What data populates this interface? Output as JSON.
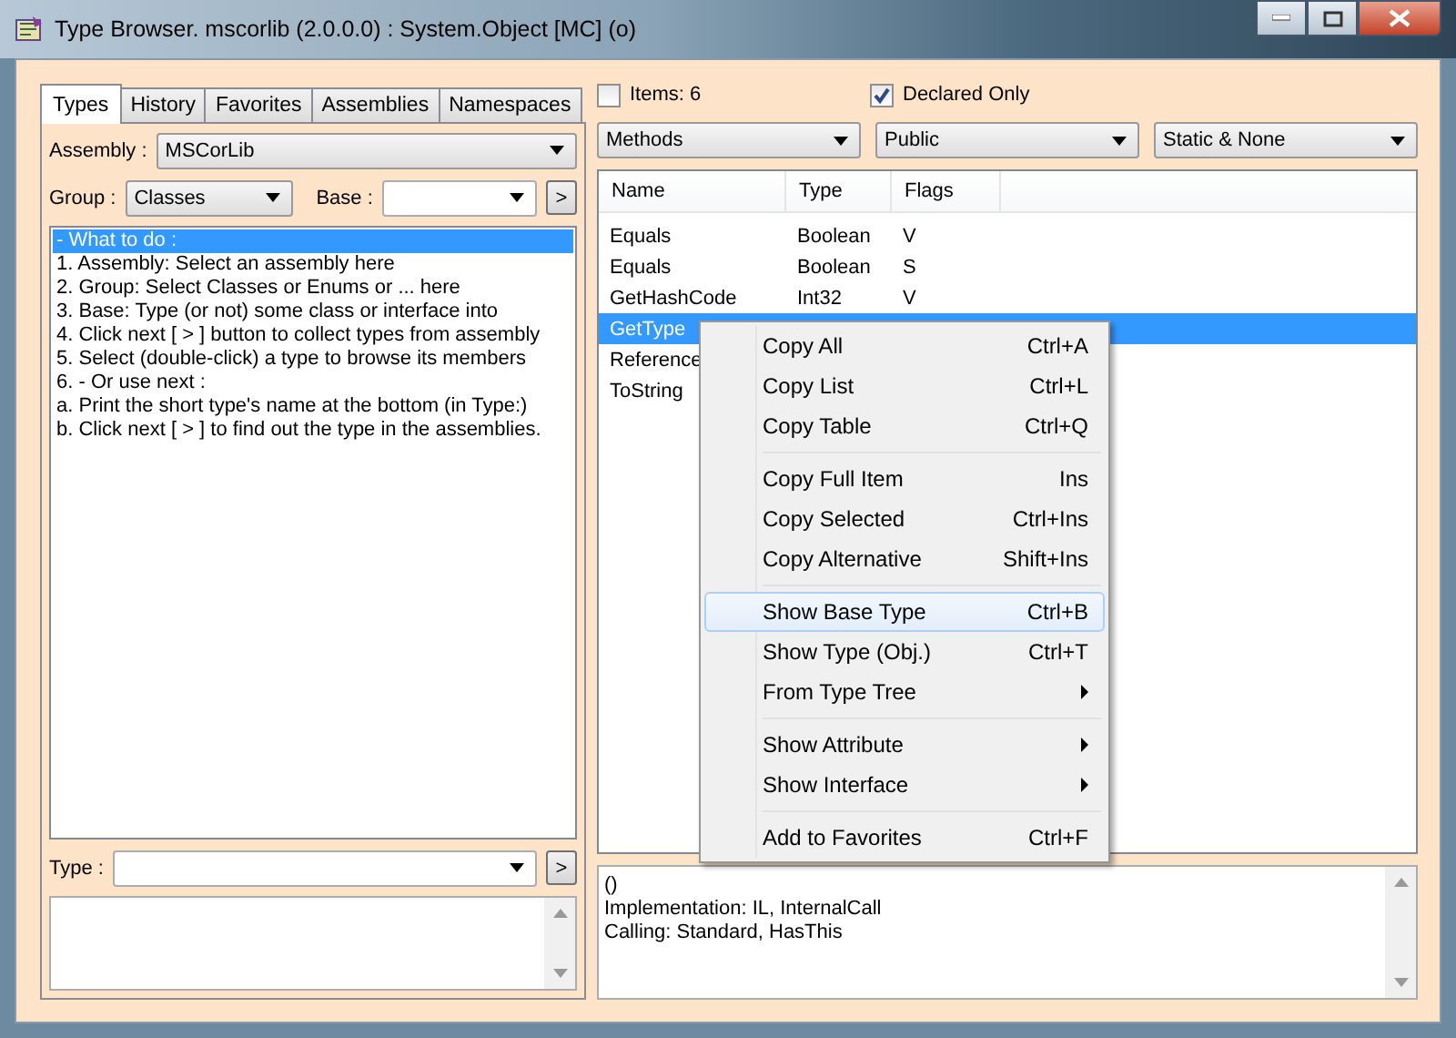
{
  "window": {
    "title": "Type Browser. mscorlib (2.0.0.0) : System.Object [MC] (o)"
  },
  "left_panel": {
    "tabs": [
      {
        "label": "Types",
        "selected": true
      },
      {
        "label": "History",
        "selected": false
      },
      {
        "label": "Favorites",
        "selected": false
      },
      {
        "label": "Assemblies",
        "selected": false
      },
      {
        "label": "Namespaces",
        "selected": false
      }
    ],
    "assembly": {
      "label": "Assembly :",
      "value": "MSCorLib"
    },
    "group": {
      "label": "Group :",
      "value": "Classes"
    },
    "base": {
      "label": "Base :"
    },
    "base_go_button": ">",
    "instructions": [
      {
        "text": "- What to do :",
        "selected": true
      },
      {
        "text": "1. Assembly: Select an assembly here",
        "selected": false
      },
      {
        "text": "2. Group: Select Classes or Enums or ... here",
        "selected": false
      },
      {
        "text": "3. Base: Type (or not) some class or interface into",
        "selected": false
      },
      {
        "text": "4. Click next [ > ] button to collect types from assembly",
        "selected": false
      },
      {
        "text": "5. Select (double-click) a type to browse its members",
        "selected": false
      },
      {
        "text": "6. - Or use next :",
        "selected": false
      },
      {
        "text": "a. Print the short type's name at the bottom (in Type:)",
        "selected": false
      },
      {
        "text": "b. Click next [ > ] to find out the type in the assemblies.",
        "selected": false
      }
    ],
    "type_field": {
      "label": "Type :"
    },
    "type_go_button": ">"
  },
  "right_panel": {
    "items_checkbox": {
      "label": "Items: 6",
      "checked": false
    },
    "declared_checkbox": {
      "label": "Declared Only",
      "checked": true
    },
    "filters": [
      "Methods",
      "Public",
      "Static & None"
    ],
    "table": {
      "columns": [
        "Name",
        "Type",
        "Flags"
      ],
      "rows": [
        {
          "cells": [
            "Equals",
            "Boolean",
            "V"
          ],
          "selected": false
        },
        {
          "cells": [
            "Equals",
            "Boolean",
            "S"
          ],
          "selected": false
        },
        {
          "cells": [
            "GetHashCode",
            "Int32",
            "V"
          ],
          "selected": false
        },
        {
          "cells": [
            "GetType"
          ],
          "selected": true
        },
        {
          "cells": [
            "Reference"
          ],
          "selected": false
        },
        {
          "cells": [
            "ToString"
          ],
          "selected": false
        }
      ]
    },
    "details": [
      "()",
      "Implementation: IL, InternalCall",
      "Calling: Standard, HasThis"
    ]
  },
  "context_menu": {
    "items": [
      {
        "kind": "item",
        "label": "Copy All",
        "shortcut": "Ctrl+A",
        "submenu": false,
        "selected": false
      },
      {
        "kind": "item",
        "label": "Copy List",
        "shortcut": "Ctrl+L",
        "submenu": false,
        "selected": false
      },
      {
        "kind": "item",
        "label": "Copy Table",
        "shortcut": "Ctrl+Q",
        "submenu": false,
        "selected": false
      },
      {
        "kind": "separator"
      },
      {
        "kind": "item",
        "label": "Copy Full Item",
        "shortcut": "Ins",
        "submenu": false,
        "selected": false
      },
      {
        "kind": "item",
        "label": "Copy Selected",
        "shortcut": "Ctrl+Ins",
        "submenu": false,
        "selected": false
      },
      {
        "kind": "item",
        "label": "Copy Alternative",
        "shortcut": "Shift+Ins",
        "submenu": false,
        "selected": false
      },
      {
        "kind": "separator"
      },
      {
        "kind": "item",
        "label": "Show Base Type",
        "shortcut": "Ctrl+B",
        "submenu": false,
        "selected": true
      },
      {
        "kind": "item",
        "label": "Show Type (Obj.)",
        "shortcut": "Ctrl+T",
        "submenu": false,
        "selected": false
      },
      {
        "kind": "item",
        "label": "From Type Tree",
        "submenu": true,
        "selected": false
      },
      {
        "kind": "separator"
      },
      {
        "kind": "item",
        "label": "Show Attribute",
        "submenu": true,
        "selected": false
      },
      {
        "kind": "item",
        "label": "Show Interface",
        "submenu": true,
        "selected": false
      },
      {
        "kind": "separator"
      },
      {
        "kind": "item",
        "label": "Add to Favorites",
        "shortcut": "Ctrl+F",
        "submenu": false,
        "selected": false
      }
    ]
  }
}
